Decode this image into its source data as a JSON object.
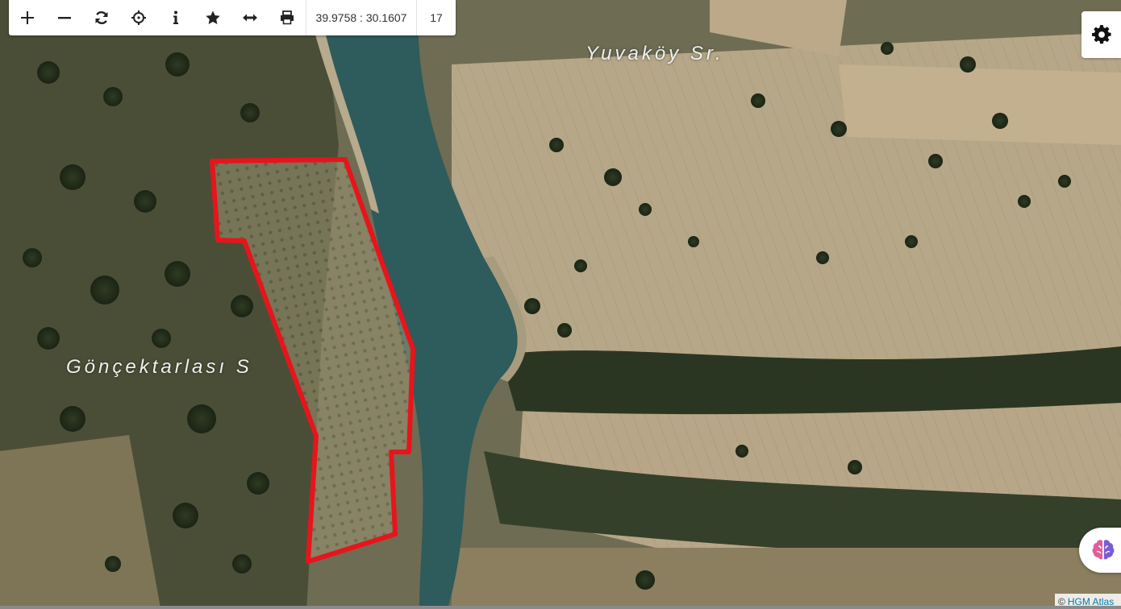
{
  "toolbar": {
    "buttons": [
      {
        "name": "zoom-in-button",
        "icon": "plus-icon"
      },
      {
        "name": "zoom-out-button",
        "icon": "minus-icon"
      },
      {
        "name": "refresh-button",
        "icon": "refresh-icon"
      },
      {
        "name": "locate-button",
        "icon": "crosshair-icon"
      },
      {
        "name": "info-button",
        "icon": "info-icon"
      },
      {
        "name": "favorite-button",
        "icon": "star-icon"
      },
      {
        "name": "measure-button",
        "icon": "horizontal-arrows-icon"
      },
      {
        "name": "print-button",
        "icon": "printer-icon"
      }
    ],
    "coordinates": "39.9758 : 30.1607",
    "zoom_level": "17"
  },
  "map": {
    "labels": {
      "yuvakoy": "Yuvaköy Sr.",
      "goncektarlasi": "Gönçektarlası S"
    },
    "parcel_outline_color": "#e8141c",
    "river_color": "#2e5b5c"
  },
  "controls": {
    "settings_icon": "gear-icon",
    "assistant_icon": "brain-icon"
  },
  "attribution": {
    "prefix": "©",
    "link_text": "HGM Atlas"
  }
}
